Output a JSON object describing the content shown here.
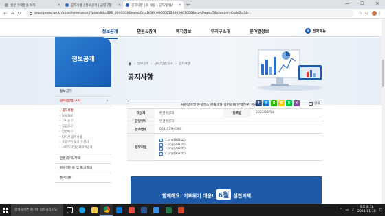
{
  "browser": {
    "tabs": [
      {
        "label": "쉬운 우리말을 쓰자",
        "active": false
      },
      {
        "label": "공지사항 | 정보공개 | 금정구청",
        "active": false
      },
      {
        "label": "공지사항 | 의 내용 | 공지/입법/",
        "active": true
      }
    ],
    "new_tab": "+",
    "url": "geumjeong.go.kr/board/view.geumj?boardId=BBS_0000004&menuCd=DOM_000000124002001000&startPage=5&categoryCode2=1&..."
  },
  "site": {
    "top_links": [
      "",
      "",
      "",
      ""
    ],
    "gnb": [
      {
        "label": "정보공개",
        "active": true
      },
      {
        "label": "민원&참여",
        "active": false
      },
      {
        "label": "복지정보",
        "active": false
      },
      {
        "label": "우리구소개",
        "active": false
      },
      {
        "label": "분야별정보",
        "active": false
      }
    ],
    "all_menu": "전체메뉴",
    "section_title": "정보공개",
    "breadcrumb": [
      "정보공개",
      "공지/입법/고시",
      "공지사항"
    ],
    "page_title": "공지사항",
    "print_label": "인쇄"
  },
  "lnb": {
    "items_top": [
      {
        "label": "정보공개",
        "active": false
      },
      {
        "label": "공지/입법/고시",
        "active": true,
        "arrow": "›"
      }
    ],
    "sub": [
      {
        "label": "- 공지사항",
        "on": true
      },
      {
        "label": "- 보도자료",
        "on": false
      },
      {
        "label": "- 고시공고",
        "on": false
      },
      {
        "label": "- 입법공고",
        "on": false
      },
      {
        "label": "- 입법예고",
        "on": false
      },
      {
        "label": "- 타기관 공지사항",
        "on": false
      },
      {
        "label": "- 유공구민 포상 수상자",
        "on": false
      },
      {
        "label": "- 사회복지법인회의록공개",
        "on": false
      }
    ],
    "items_bottom": [
      {
        "label": "현황/정책/계약"
      },
      {
        "label": "위원회현황 및 회의결과"
      },
      {
        "label": "통계현황"
      }
    ]
  },
  "post": {
    "subject": "시민참여형 온실가스 감축 6월 실천과제(단백친구, 탄플라) 홍보",
    "author_label": "작성자",
    "author": "환경위생과",
    "date_label": "등록일",
    "date": "2023/06/14",
    "dept_label": "담당부서",
    "dept": "환경위생과",
    "phone_label": "전화번호",
    "phone": "051)519-4382",
    "files_label": "첨부파일",
    "files": [
      "1.png(881kb)",
      "2.png(291kb)",
      "3.png(298kb)",
      "4.png(967kb)"
    ],
    "poster_text_a": "함께해요. 기후위기 대응!",
    "poster_month": "6월",
    "poster_text_b": "실천과제"
  },
  "taskbar": {
    "search_placeholder": "검색하려면 여기에 입력하십시오.",
    "time": "오후 8:18",
    "date": "2021-11-30"
  },
  "colors": {
    "brand_blue": "#165cb7",
    "active_red": "#d9342b",
    "sns": [
      "#3b5998",
      "#1da1f2",
      "#2db400",
      "#ffcd00",
      "#00c73c",
      "#7f4fa0"
    ]
  }
}
